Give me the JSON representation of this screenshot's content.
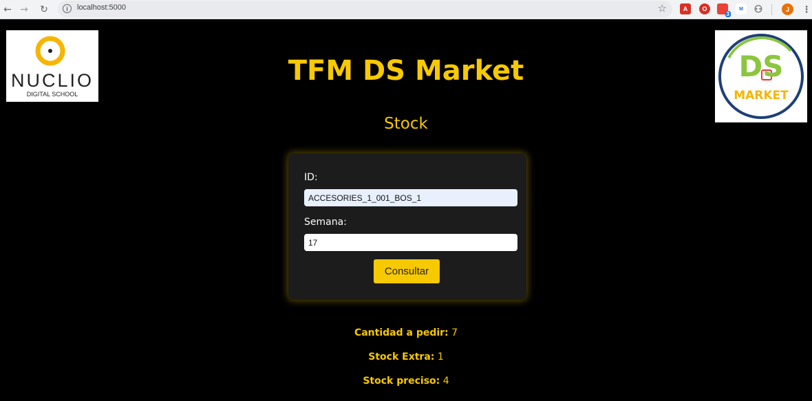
{
  "browser": {
    "url": "localhost:5000",
    "profile_initial": "J",
    "extensions": [
      {
        "name": "pdf-extension-icon",
        "color": "#d93025",
        "glyph": "A"
      },
      {
        "name": "shield-extension-icon",
        "color": "#d93025",
        "glyph": "O"
      },
      {
        "name": "notification-extension-icon",
        "color": "#ea4335",
        "glyph": "3"
      },
      {
        "name": "translate-extension-icon",
        "color": "#ffffff",
        "glyph": "M"
      }
    ]
  },
  "logos": {
    "left_name": "NUCLIO",
    "left_sub": "DIGITAL SCHOOL",
    "right_name": "DS",
    "right_sub": "MARKET"
  },
  "header": {
    "title": "TFM DS Market",
    "subtitle": "Stock"
  },
  "form": {
    "id_label": "ID:",
    "id_value": "ACCESORIES_1_001_BOS_1",
    "week_label": "Semana:",
    "week_value": "17",
    "submit_label": "Consultar"
  },
  "results": {
    "order_label": "Cantidad a pedir:",
    "order_value": "7",
    "extra_label": "Stock Extra:",
    "extra_value": "1",
    "precise_label": "Stock preciso:",
    "precise_value": "4"
  },
  "colors": {
    "accent": "#f7c900",
    "background": "#000000",
    "card": "#1c1c1c"
  }
}
